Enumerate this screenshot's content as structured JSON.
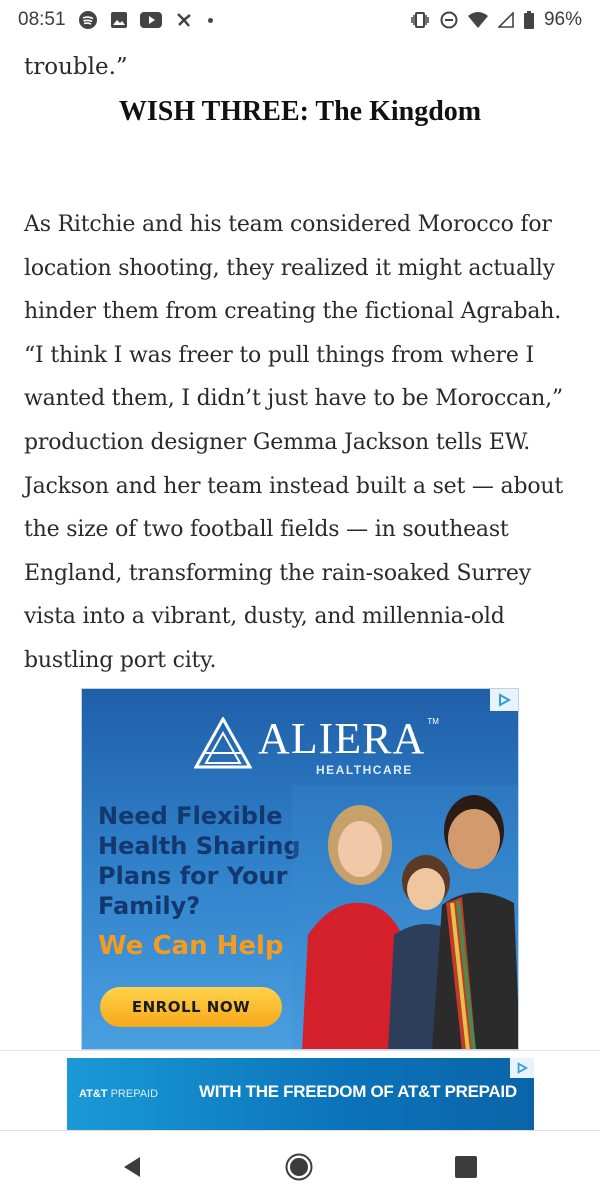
{
  "status_bar": {
    "time": "08:51",
    "battery": "96%",
    "left_icons": [
      "spotify-icon",
      "image-icon",
      "youtube-icon",
      "pinwheel-icon",
      "dot-icon"
    ],
    "right_icons": [
      "vibrate-icon",
      "dnd-icon",
      "wifi-icon",
      "signal-icon",
      "battery-icon"
    ]
  },
  "article": {
    "fragment": "trouble.”",
    "heading": "WISH THREE: The Kingdom",
    "body": "As Ritchie and his team considered Morocco for location shooting, they realized it might actually hinder them from creating the fictional Agrabah. “I think I was freer to pull things from where I wanted them, I didn’t just have to be Moroccan,” production designer Gemma Jackson tells EW. Jackson and her team instead built a set — about the size of two football fields — in southeast England, transforming the rain-soaked Surrey vista into a vibrant, dusty, and millennia-old bustling port city."
  },
  "ad1": {
    "brand": "ALIERA",
    "tm": "TM",
    "brand_sub": "HEALTHCARE",
    "headline": "Need Flexible Health Sharing Plans for Your Family?",
    "tagline": "We Can Help",
    "cta": "ENROLL NOW",
    "colors": {
      "bg": "#2f7fc8",
      "headline": "#12386d",
      "tagline": "#f39c1f",
      "cta": "#f7a81a"
    }
  },
  "ad2": {
    "brand": "AT&T",
    "brand_sub": "PREPAID",
    "text": "WITH THE FREEDOM OF AT&T PREPAID"
  },
  "nav": {
    "icons": [
      "back-icon",
      "home-icon",
      "recents-icon"
    ]
  }
}
